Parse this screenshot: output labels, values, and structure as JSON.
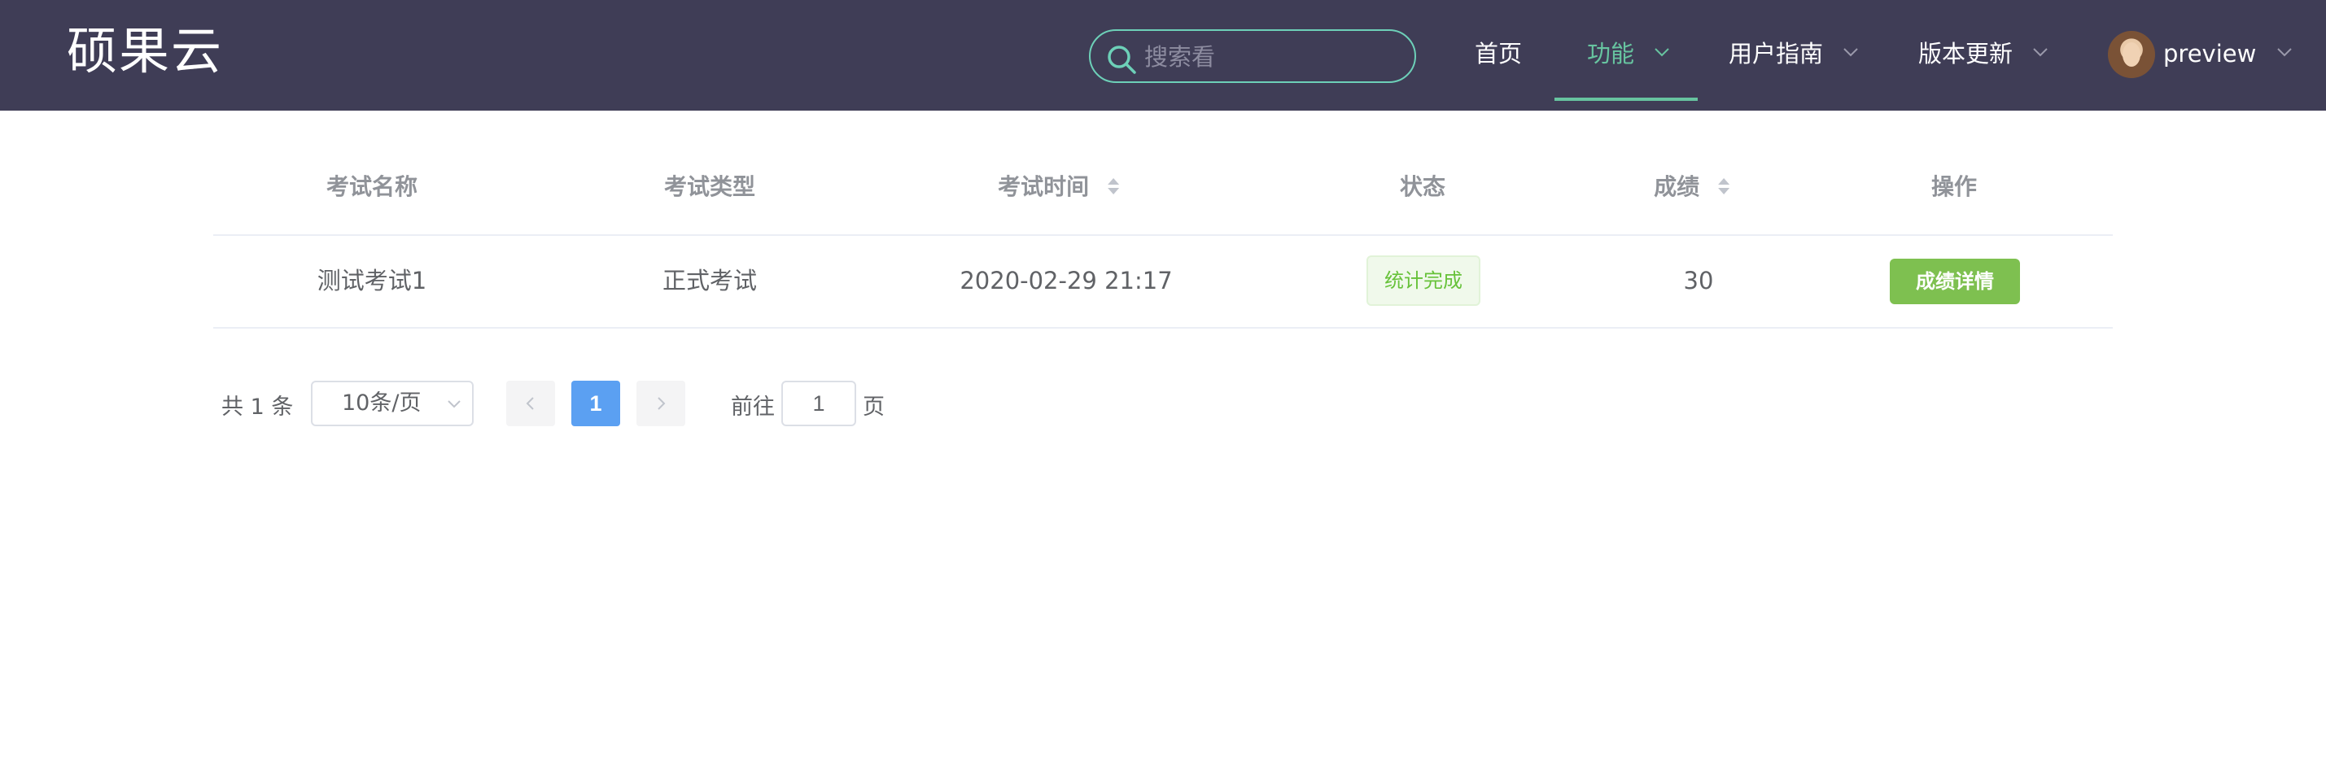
{
  "header": {
    "logo": "硕果云",
    "search_placeholder": "搜索看",
    "nav": [
      {
        "label": "首页"
      },
      {
        "label": "功能"
      },
      {
        "label": "用户指南"
      },
      {
        "label": "版本更新"
      }
    ],
    "active_nav": "功能",
    "user": {
      "name": "preview"
    },
    "accent_color": "#67c4a0",
    "background_color": "#3f3d56"
  },
  "table": {
    "columns": [
      {
        "label": "考试名称"
      },
      {
        "label": "考试类型"
      },
      {
        "label": "考试时间",
        "sortable": true
      },
      {
        "label": "状态"
      },
      {
        "label": "成绩",
        "sortable": true
      },
      {
        "label": "操作"
      }
    ],
    "rows": [
      {
        "name": "测试考试1",
        "type": "正式考试",
        "time": "2020-02-29 21:17",
        "status": "统计完成",
        "score": "30",
        "action": "成绩详情"
      }
    ]
  },
  "pagination": {
    "total_text": "共 1 条",
    "page_size": "10条/页",
    "current_page": "1",
    "goto_label": "前往",
    "goto_value": "1",
    "goto_suffix": "页"
  },
  "icons": [
    "search-icon",
    "chevron-down-icon",
    "sort-icon",
    "chevron-left-icon",
    "chevron-right-icon",
    "avatar"
  ]
}
